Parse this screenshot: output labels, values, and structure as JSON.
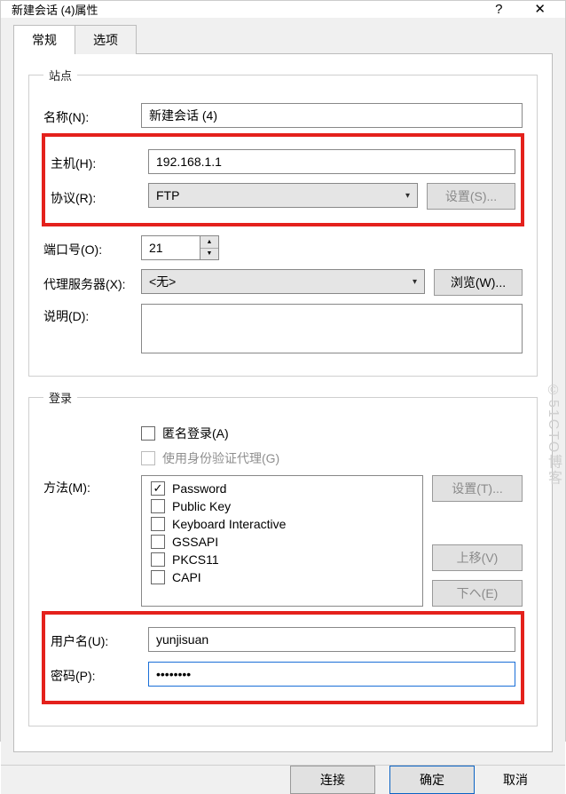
{
  "window": {
    "title": "新建会话 (4)属性",
    "help_icon": "?",
    "close_icon": "✕"
  },
  "tabs": {
    "general": "常规",
    "options": "选项"
  },
  "site": {
    "legend": "站点",
    "name_label": "名称(N):",
    "name_value": "新建会话 (4)",
    "host_label": "主机(H):",
    "host_value": "192.168.1.1",
    "protocol_label": "协议(R):",
    "protocol_value": "FTP",
    "settings_btn": "设置(S)...",
    "port_label": "端口号(O):",
    "port_value": "21",
    "proxy_label": "代理服务器(X):",
    "proxy_value": "<无>",
    "browse_btn": "浏览(W)...",
    "desc_label": "说明(D):",
    "desc_value": ""
  },
  "login": {
    "legend": "登录",
    "anon_label": "匿名登录(A)",
    "authproxy_label": "使用身份验证代理(G)",
    "method_label": "方法(M):",
    "methods": [
      {
        "label": "Password",
        "checked": true
      },
      {
        "label": "Public Key",
        "checked": false
      },
      {
        "label": "Keyboard Interactive",
        "checked": false
      },
      {
        "label": "GSSAPI",
        "checked": false
      },
      {
        "label": "PKCS11",
        "checked": false
      },
      {
        "label": "CAPI",
        "checked": false
      }
    ],
    "set_btn": "设置(T)...",
    "up_btn": "上移(V)",
    "down_btn": "下ヘ(E)",
    "user_label": "用户名(U):",
    "user_value": "yunjisuan",
    "pass_label": "密码(P):",
    "pass_value": "••••••••"
  },
  "footer": {
    "connect": "连接",
    "ok": "确定",
    "cancel": "取消"
  },
  "watermark": "©51CTO博客"
}
